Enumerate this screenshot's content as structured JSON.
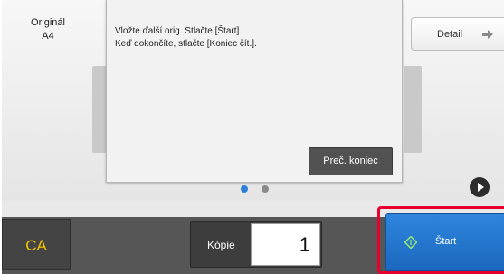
{
  "original": {
    "label": "Originál",
    "size": "A4"
  },
  "detail_button": {
    "label": "Detail",
    "icon": "arrow-right-icon"
  },
  "dialog": {
    "message_line1": "Vložte ďalší orig. Stlačte [Štart].",
    "message_line2": "Keď dokončíte, stlačte [Koniec čít.].",
    "button_label": "Preč. koniec"
  },
  "pager": {
    "pages": 2,
    "active_page": 1
  },
  "bottom_bar": {
    "ca_label": "CA",
    "copies_label": "Kópie",
    "copies_value": "1",
    "start_label": "Štart",
    "start_icon": "start-diamond-icon"
  },
  "colors": {
    "ca_text": "#f0c000",
    "start_button": "#2379d2",
    "highlight_frame": "#e5002e",
    "active_dot": "#2f7fd8"
  }
}
